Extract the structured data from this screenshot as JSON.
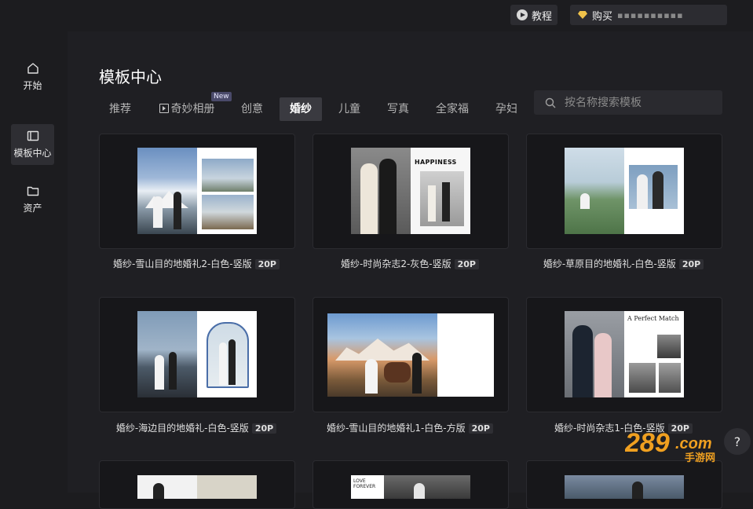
{
  "topbar": {
    "tutorial_label": "教程",
    "buy_label": "购买",
    "buy_extra": "▪▪▪▪▪▪▪▪▪▪"
  },
  "sidebar": {
    "items": [
      {
        "label": "开始",
        "icon": "home-icon"
      },
      {
        "label": "模板中心",
        "icon": "template-icon",
        "active": true
      },
      {
        "label": "资产",
        "icon": "folder-icon"
      }
    ]
  },
  "main": {
    "title": "模板中心",
    "tabs": [
      {
        "label": "推荐"
      },
      {
        "label": "奇妙相册",
        "badge": "New"
      },
      {
        "label": "创意"
      },
      {
        "label": "婚纱",
        "active": true
      },
      {
        "label": "儿童"
      },
      {
        "label": "写真"
      },
      {
        "label": "全家福"
      },
      {
        "label": "孕妇"
      }
    ],
    "search_placeholder": "按名称搜索模板",
    "templates": [
      {
        "name": "婚纱-雪山目的地婚礼2-白色-竖版",
        "pages": "20P"
      },
      {
        "name": "婚纱-时尚杂志2-灰色-竖版",
        "pages": "20P"
      },
      {
        "name": "婚纱-草原目的地婚礼-白色-竖版",
        "pages": "20P"
      },
      {
        "name": "婚纱-海边目的地婚礼-白色-竖版",
        "pages": "20P"
      },
      {
        "name": "婚纱-雪山目的地婚礼1-白色-方版",
        "pages": "20P"
      },
      {
        "name": "婚纱-时尚杂志1-白色-竖版",
        "pages": "20P"
      }
    ],
    "thumb_text": {
      "happiness": "HAPPINESS",
      "perfect_match": "A Perfect Match",
      "love_forever": "LOVE FOREVER"
    }
  },
  "help_label": "?",
  "watermark": {
    "number": "289",
    "suffix": ".com",
    "sub": "手游网"
  },
  "colors": {
    "background": "#1c1c1f",
    "card": "#17171a",
    "active_tab": "#3a3a40",
    "watermark": "#f0a020"
  }
}
